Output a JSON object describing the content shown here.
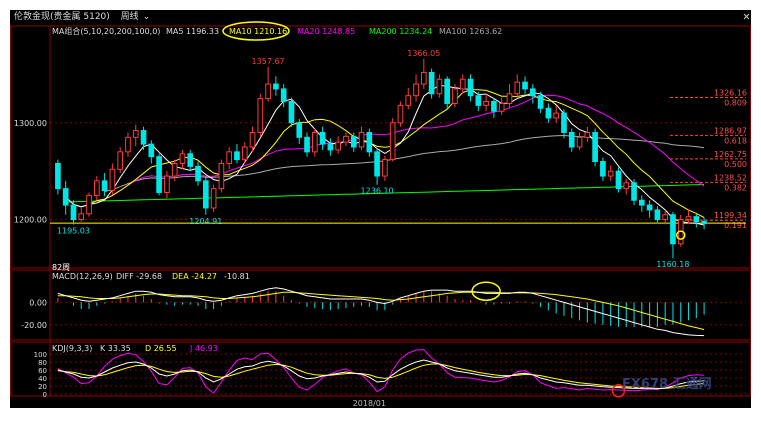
{
  "window": {
    "title": "伦敦金现(贵金属 5120)",
    "period": "周线",
    "period_icon": "chevron-down-icon",
    "close_icon": "close-icon"
  },
  "watermark": "FX678 汇通网",
  "colors": {
    "bg": "#000000",
    "up": "#ff3b3b",
    "down": "#00e5e5",
    "ma5": "#ffffff",
    "ma10": "#ffff00",
    "ma20": "#ff00ff",
    "ma200": "#00ff00",
    "ma100": "#aaaaaa",
    "grid": "#8b0000",
    "highlight": "#ffff00",
    "marker_red": "#ff2020"
  },
  "chart_data": [
    {
      "type": "candlestick",
      "legend": {
        "name": "MA组合(5,10,20,200,100,0)",
        "items": [
          {
            "key": "ma5",
            "label": "MA5 1196.33"
          },
          {
            "key": "ma10",
            "label": "MA10 1210.16"
          },
          {
            "key": "ma20",
            "label": "MA20 1248.85"
          },
          {
            "key": "ma200",
            "label": "MA200 1234.24"
          },
          {
            "key": "ma100",
            "label": "MA100 1263.62"
          }
        ]
      },
      "yticks": [
        1200,
        1300
      ],
      "ytick_labels": [
        "1200.00",
        "1300.00"
      ],
      "ylim": [
        1150,
        1400
      ],
      "annotations": [
        {
          "label": "1357.67",
          "idx": 27,
          "value": 1357.67,
          "color": "#ff3b3b"
        },
        {
          "label": "1366.05",
          "idx": 47,
          "value": 1366.05,
          "color": "#ff3b3b"
        },
        {
          "label": "1236.10",
          "idx": 41,
          "value": 1236.1,
          "color": "#00e5e5"
        },
        {
          "label": "1204.91",
          "idx": 19,
          "value": 1204.91,
          "color": "#00e5e5"
        },
        {
          "label": "1195.03",
          "idx": 2,
          "value": 1195.03,
          "color": "#00e5e5"
        },
        {
          "label": "1160.18",
          "idx": 79,
          "value": 1160.18,
          "color": "#00e5e5"
        },
        {
          "label": "82周",
          "idx": 0,
          "value": 1152,
          "color": "#ffffff"
        }
      ],
      "fib_levels": [
        {
          "value": 1326.16,
          "label": "1326.16",
          "ratio": "0.809"
        },
        {
          "value": 1286.97,
          "label": "1286.97",
          "ratio": "0.618"
        },
        {
          "value": 1262.75,
          "label": "1262.75",
          "ratio": "0.500"
        },
        {
          "value": 1238.52,
          "label": "1238.52",
          "ratio": "0.382"
        },
        {
          "value": 1199.34,
          "label": "1199.34",
          "ratio": "0.191"
        }
      ],
      "current_price": 1196.3,
      "candles": [
        [
          1258,
          1232,
          1262,
          1226
        ],
        [
          1232,
          1215,
          1240,
          1205
        ],
        [
          1215,
          1200,
          1220,
          1195
        ],
        [
          1200,
          1206,
          1212,
          1198
        ],
        [
          1206,
          1225,
          1228,
          1203
        ],
        [
          1225,
          1240,
          1245,
          1220
        ],
        [
          1240,
          1230,
          1248,
          1224
        ],
        [
          1230,
          1252,
          1258,
          1226
        ],
        [
          1252,
          1270,
          1275,
          1248
        ],
        [
          1270,
          1285,
          1290,
          1265
        ],
        [
          1285,
          1292,
          1298,
          1276
        ],
        [
          1292,
          1278,
          1296,
          1272
        ],
        [
          1278,
          1265,
          1282,
          1258
        ],
        [
          1265,
          1228,
          1268,
          1225
        ],
        [
          1228,
          1245,
          1250,
          1222
        ],
        [
          1245,
          1258,
          1262,
          1240
        ],
        [
          1258,
          1268,
          1272,
          1252
        ],
        [
          1268,
          1255,
          1272,
          1250
        ],
        [
          1255,
          1240,
          1260,
          1235
        ],
        [
          1240,
          1212,
          1245,
          1205
        ],
        [
          1212,
          1232,
          1236,
          1208
        ],
        [
          1232,
          1258,
          1262,
          1228
        ],
        [
          1258,
          1270,
          1275,
          1252
        ],
        [
          1270,
          1262,
          1278,
          1258
        ],
        [
          1262,
          1275,
          1280,
          1258
        ],
        [
          1275,
          1290,
          1296,
          1270
        ],
        [
          1290,
          1325,
          1330,
          1285
        ],
        [
          1325,
          1340,
          1358,
          1322
        ],
        [
          1340,
          1335,
          1348,
          1328
        ],
        [
          1335,
          1322,
          1340,
          1316
        ],
        [
          1322,
          1300,
          1326,
          1296
        ],
        [
          1300,
          1285,
          1304,
          1278
        ],
        [
          1285,
          1270,
          1290,
          1265
        ],
        [
          1270,
          1290,
          1294,
          1265
        ],
        [
          1290,
          1278,
          1296,
          1272
        ],
        [
          1278,
          1272,
          1284,
          1266
        ],
        [
          1272,
          1280,
          1286,
          1268
        ],
        [
          1280,
          1286,
          1290,
          1276
        ],
        [
          1286,
          1275,
          1290,
          1270
        ],
        [
          1275,
          1290,
          1296,
          1272
        ],
        [
          1290,
          1270,
          1294,
          1265
        ],
        [
          1270,
          1245,
          1274,
          1236
        ],
        [
          1245,
          1262,
          1266,
          1240
        ],
        [
          1262,
          1300,
          1305,
          1260
        ],
        [
          1300,
          1318,
          1322,
          1296
        ],
        [
          1318,
          1328,
          1336,
          1314
        ],
        [
          1328,
          1340,
          1350,
          1322
        ],
        [
          1340,
          1352,
          1366,
          1335
        ],
        [
          1352,
          1330,
          1356,
          1325
        ],
        [
          1330,
          1345,
          1350,
          1326
        ],
        [
          1345,
          1320,
          1348,
          1314
        ],
        [
          1320,
          1335,
          1340,
          1316
        ],
        [
          1335,
          1345,
          1350,
          1330
        ],
        [
          1345,
          1328,
          1350,
          1322
        ],
        [
          1328,
          1318,
          1332,
          1312
        ],
        [
          1318,
          1322,
          1330,
          1312
        ],
        [
          1322,
          1312,
          1326,
          1305
        ],
        [
          1312,
          1320,
          1326,
          1308
        ],
        [
          1320,
          1330,
          1340,
          1316
        ],
        [
          1330,
          1342,
          1350,
          1326
        ],
        [
          1342,
          1335,
          1348,
          1330
        ],
        [
          1335,
          1328,
          1340,
          1320
        ],
        [
          1328,
          1315,
          1332,
          1310
        ],
        [
          1315,
          1305,
          1320,
          1300
        ],
        [
          1305,
          1310,
          1318,
          1300
        ],
        [
          1310,
          1290,
          1314,
          1284
        ],
        [
          1290,
          1275,
          1294,
          1270
        ],
        [
          1275,
          1285,
          1290,
          1272
        ],
        [
          1285,
          1290,
          1296,
          1280
        ],
        [
          1290,
          1260,
          1294,
          1255
        ],
        [
          1260,
          1245,
          1264,
          1240
        ],
        [
          1245,
          1250,
          1256,
          1240
        ],
        [
          1250,
          1232,
          1254,
          1228
        ],
        [
          1232,
          1238,
          1242,
          1226
        ],
        [
          1238,
          1220,
          1242,
          1215
        ],
        [
          1220,
          1215,
          1225,
          1208
        ],
        [
          1215,
          1210,
          1220,
          1202
        ],
        [
          1210,
          1200,
          1214,
          1196
        ],
        [
          1200,
          1205,
          1210,
          1195
        ],
        [
          1205,
          1175,
          1208,
          1160
        ],
        [
          1175,
          1200,
          1205,
          1172
        ],
        [
          1200,
          1203,
          1210,
          1196
        ],
        [
          1203,
          1198,
          1206,
          1192
        ],
        [
          1198,
          1196,
          1202,
          1190
        ]
      ]
    },
    {
      "type": "line",
      "legend": {
        "name": "MACD(12,26,9)",
        "items": [
          {
            "key": "diff",
            "label": "DIFF -29.68"
          },
          {
            "key": "dea",
            "label": "DEA -24.27"
          },
          {
            "key": "macd",
            "label": "-10.81"
          }
        ]
      },
      "yticks": [
        0,
        -20
      ],
      "ytick_labels": [
        "0.00",
        "-20.00"
      ],
      "ylim": [
        -30,
        20
      ],
      "diff": [
        8,
        6,
        4,
        2,
        1,
        2,
        3,
        4,
        6,
        8,
        10,
        10,
        9,
        7,
        6,
        5,
        5,
        5,
        4,
        2,
        1,
        2,
        4,
        6,
        7,
        8,
        10,
        12,
        13,
        12,
        10,
        8,
        6,
        5,
        4,
        3,
        3,
        3,
        3,
        3,
        2,
        0,
        -1,
        1,
        4,
        6,
        8,
        10,
        11,
        11,
        11,
        10,
        10,
        10,
        9,
        8,
        8,
        8,
        8,
        9,
        9,
        8,
        6,
        4,
        2,
        0,
        -2,
        -4,
        -6,
        -8,
        -10,
        -12,
        -14,
        -16,
        -18,
        -20,
        -22,
        -24,
        -25,
        -27,
        -28,
        -29,
        -29.5,
        -29.68
      ],
      "dea": [
        6,
        6,
        5.5,
        5,
        4,
        3.5,
        3.5,
        3.5,
        4,
        5,
        6,
        7,
        7.5,
        7.5,
        7,
        6.5,
        6,
        6,
        5.5,
        5,
        4,
        3.5,
        3.5,
        4,
        4.5,
        5,
        6,
        7,
        8,
        9,
        9,
        8.5,
        8,
        7.5,
        7,
        6.5,
        6,
        5.5,
        5,
        4.5,
        4,
        3.5,
        2.5,
        2,
        2.5,
        3,
        4,
        5,
        6,
        7,
        8,
        8.5,
        9,
        9,
        9,
        9,
        9,
        8.5,
        8.5,
        8.5,
        8.5,
        8.5,
        8,
        7.5,
        7,
        6,
        5,
        4,
        3,
        1.5,
        0,
        -1.5,
        -3,
        -5,
        -7,
        -9,
        -11,
        -13,
        -15,
        -17,
        -19,
        -21,
        -22.5,
        -24.27
      ]
    },
    {
      "type": "line",
      "legend": {
        "name": "KDJ(9,3,3)",
        "items": [
          {
            "key": "k",
            "label": "K 33.35"
          },
          {
            "key": "d",
            "label": "D 26.55"
          },
          {
            "key": "j",
            "label": "J 46.93"
          }
        ]
      },
      "yticks": [
        100,
        80,
        60,
        40,
        20,
        0
      ],
      "ytick_labels": [
        "100",
        "80",
        "60",
        "40",
        "20",
        "0"
      ],
      "ylim": [
        0,
        105
      ],
      "k": [
        60,
        55,
        50,
        42,
        40,
        45,
        55,
        65,
        72,
        78,
        80,
        75,
        65,
        50,
        45,
        50,
        58,
        60,
        55,
        40,
        30,
        38,
        50,
        62,
        68,
        70,
        78,
        82,
        78,
        70,
        58,
        45,
        38,
        40,
        45,
        48,
        52,
        55,
        52,
        50,
        42,
        30,
        32,
        48,
        62,
        72,
        80,
        85,
        80,
        75,
        65,
        58,
        55,
        52,
        48,
        45,
        42,
        42,
        45,
        50,
        52,
        48,
        40,
        35,
        30,
        28,
        25,
        22,
        22,
        20,
        18,
        17,
        16,
        15,
        14,
        14,
        14,
        13,
        15,
        20,
        26,
        30,
        32,
        33.35
      ],
      "d": [
        58,
        56,
        54,
        50,
        46,
        45,
        48,
        54,
        60,
        66,
        71,
        72,
        69,
        62,
        56,
        54,
        55,
        57,
        56,
        51,
        44,
        42,
        45,
        51,
        57,
        62,
        67,
        72,
        74,
        72,
        67,
        59,
        52,
        48,
        47,
        47,
        49,
        51,
        52,
        51,
        48,
        42,
        39,
        42,
        49,
        57,
        65,
        72,
        75,
        75,
        71,
        66,
        62,
        58,
        54,
        51,
        48,
        46,
        46,
        47,
        49,
        48,
        46,
        42,
        38,
        34,
        31,
        28,
        26,
        24,
        22,
        20,
        19,
        18,
        17,
        16,
        15,
        14,
        14,
        16,
        19,
        22,
        24,
        26.55
      ],
      "j": [
        64,
        53,
        42,
        26,
        28,
        45,
        69,
        87,
        96,
        102,
        98,
        81,
        57,
        26,
        23,
        42,
        64,
        66,
        53,
        18,
        2,
        30,
        60,
        84,
        90,
        86,
        100,
        102,
        86,
        66,
        40,
        17,
        10,
        24,
        41,
        50,
        58,
        63,
        52,
        48,
        30,
        6,
        18,
        60,
        88,
        102,
        110,
        111,
        90,
        75,
        53,
        42,
        41,
        40,
        36,
        33,
        30,
        34,
        43,
        56,
        58,
        48,
        28,
        21,
        14,
        16,
        13,
        10,
        14,
        12,
        10,
        11,
        10,
        9,
        8,
        10,
        12,
        11,
        17,
        28,
        40,
        46,
        48,
        46.93
      ]
    }
  ],
  "xaxis": {
    "label": "2018/01",
    "idx": 40
  }
}
